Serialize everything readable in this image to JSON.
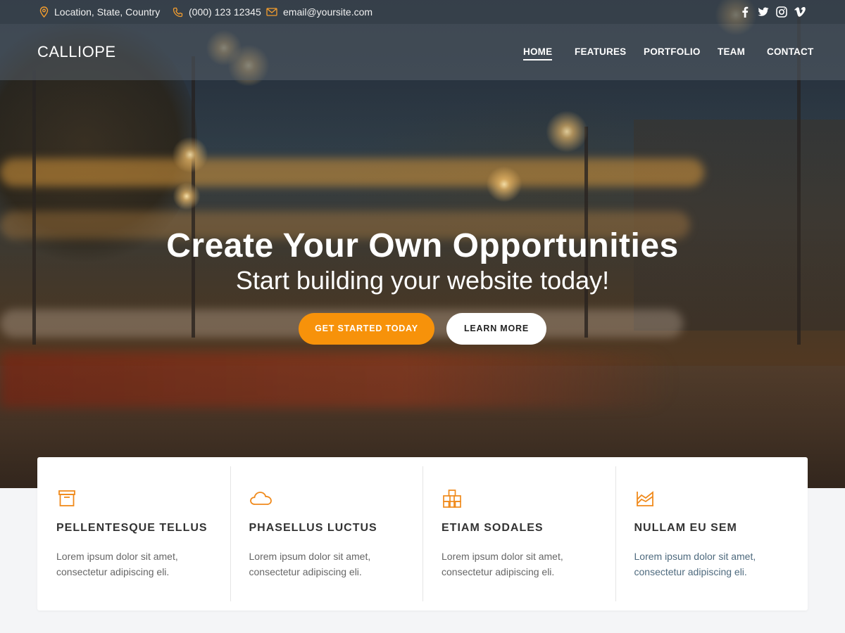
{
  "topbar": {
    "location": "Location, State, Country",
    "phone": "(000) 123 12345",
    "email": "email@yoursite.com",
    "social_icons": [
      "facebook-icon",
      "twitter-icon",
      "instagram-icon",
      "vimeo-icon"
    ]
  },
  "nav": {
    "logo": "CALLIOPE",
    "items": [
      {
        "label": "HOME",
        "active": true
      },
      {
        "label": "FEATURES",
        "active": false
      },
      {
        "label": "PORTFOLIO",
        "active": false
      },
      {
        "label": "TEAM",
        "active": false
      },
      {
        "label": "CONTACT",
        "active": false
      }
    ]
  },
  "hero": {
    "title": "Create Your Own Opportunities",
    "subtitle": "Start building your website today!",
    "primary_button": "GET STARTED TODAY",
    "secondary_button": "LEARN MORE"
  },
  "features": [
    {
      "icon": "archive-box-icon",
      "title": "PELLENTESQUE TELLUS",
      "text": "Lorem ipsum dolor sit amet, consectetur adipiscing eli."
    },
    {
      "icon": "cloud-icon",
      "title": "PHASELLUS LUCTUS",
      "text": "Lorem ipsum dolor sit amet, consectetur adipiscing eli."
    },
    {
      "icon": "cubes-icon",
      "title": "ETIAM SODALES",
      "text": "Lorem ipsum dolor sit amet, consectetur adipiscing eli."
    },
    {
      "icon": "area-chart-icon",
      "title": "NULLAM EU SEM",
      "text": "Lorem ipsum dolor sit amet, consectetur adipiscing eli."
    }
  ],
  "colors": {
    "accent": "#f7920a",
    "icon": "#f08a1c",
    "page_background": "#f4f5f7"
  }
}
